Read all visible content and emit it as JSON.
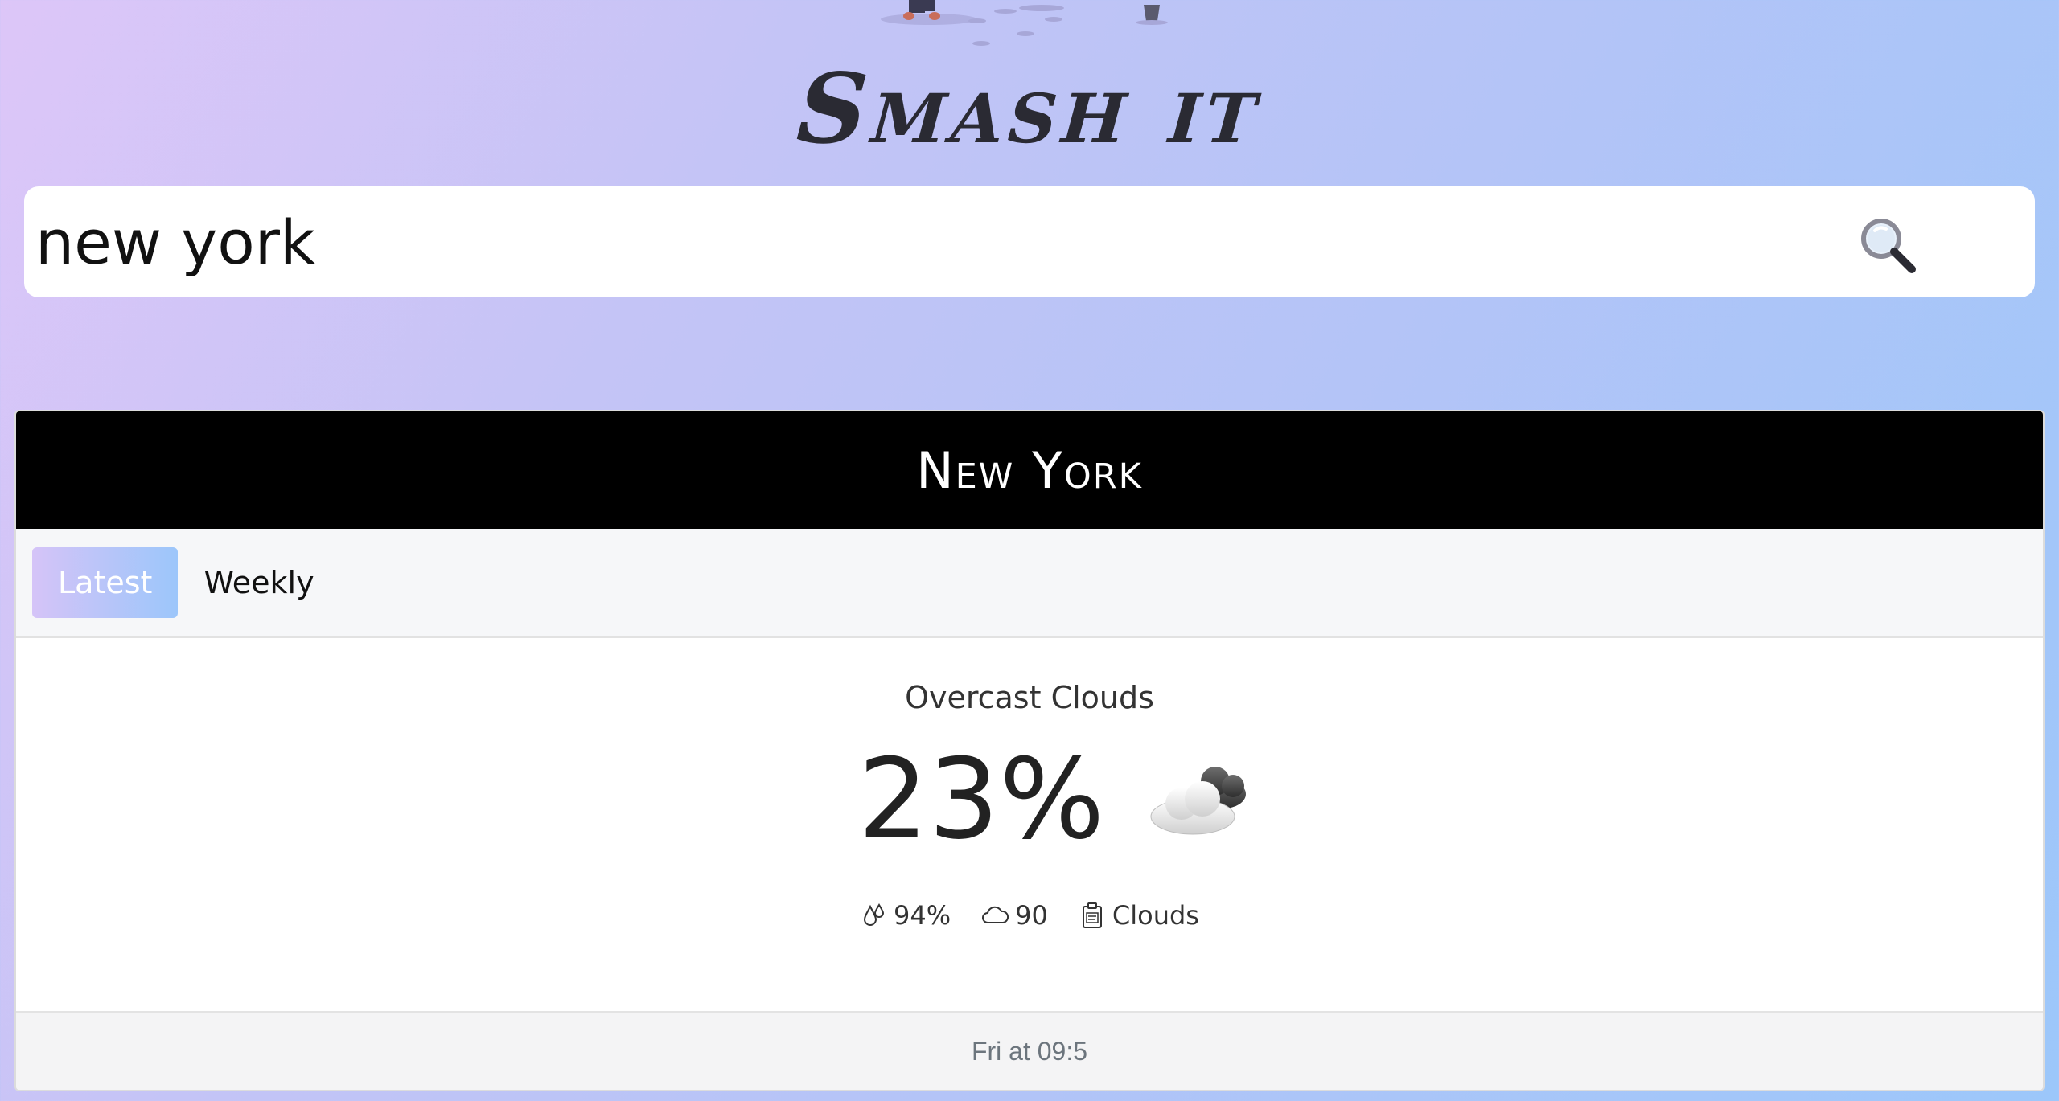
{
  "brand": {
    "title": "Smash it"
  },
  "search": {
    "value": "new york",
    "icon": "magnifier-icon"
  },
  "card": {
    "city": "New York",
    "tabs": [
      {
        "label": "Latest",
        "active": true
      },
      {
        "label": "Weekly",
        "active": false
      }
    ],
    "description": "Overcast Clouds",
    "temperature": "23%",
    "weather_icon": "cloud-icon",
    "stats": {
      "humidity": "94%",
      "clouds": "90",
      "condition": "Clouds"
    },
    "footer": "Fri at 09:5"
  },
  "colors": {
    "tab_active_start": "#d5c4f8",
    "tab_active_end": "#9cc6fa",
    "header_bg": "#000000"
  }
}
